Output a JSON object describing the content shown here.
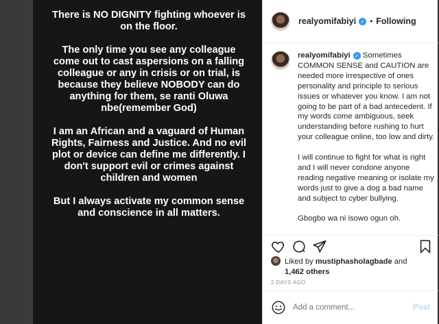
{
  "image_text": {
    "paragraphs": [
      "There is NO DIGNITY fighting whoever is on the floor.",
      "The only time you see any colleague come out to cast aspersions on a falling colleague or any in crisis or on trial, is because they believe NOBODY can do anything for them, se ranti Oluwa nbe(remember God)",
      "I am an African and a vaguard of Human Rights, Fairness and Justice. And no evil plot or device can define me differently. I don't support evil or crimes against children and women",
      "But I always activate my common sense and conscience in all matters."
    ]
  },
  "header": {
    "username": "realyomifabiyi",
    "separator": "•",
    "follow_status": "Following"
  },
  "caption": {
    "username": "realyomifabiyi",
    "paragraphs": [
      "Sometimes COMMON SENSE and CAUTION are needed more irrespective of ones personality and principle to serious issues or whatever you know. I am not going to be part of a bad antecedent. If my words come ambiguous, seek understanding before rushing to hurt your colleague online, too low and dirty.",
      "I will continue to fight for what is right and I will never condone anyone reading negative meaning or isolate my words just to give a dog a bad name and subject to cyber bullying.",
      "Gbogbo wa ni isowo ogun oh."
    ]
  },
  "icons": {
    "like": "heart-icon",
    "comment": "comment-icon",
    "share": "paper-plane-icon",
    "save": "bookmark-icon",
    "emoji": "smiley-icon",
    "verified": "verified-badge-icon"
  },
  "likes": {
    "prefix": "Liked by ",
    "user": "mustiphasholagbade",
    "and": " and",
    "others": "1,462 others"
  },
  "timestamp": "2 DAYS AGO",
  "comment": {
    "placeholder": "Add a comment...",
    "post_label": "Post"
  },
  "colors": {
    "verified": "#3897f0",
    "post_disabled": "#b2dffc",
    "muted": "#8e8e8e"
  }
}
